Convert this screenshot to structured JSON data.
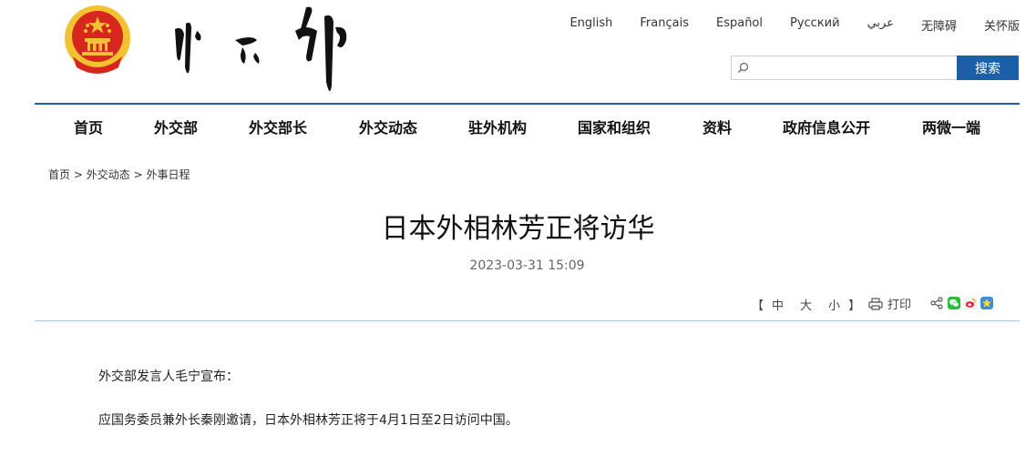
{
  "languages": [
    "English",
    "Français",
    "Español",
    "Русский",
    "عربي",
    "无障碍",
    "关怀版"
  ],
  "search": {
    "placeholder": "",
    "button_label": "搜索"
  },
  "nav": [
    "首页",
    "外交部",
    "外交部长",
    "外交动态",
    "驻外机构",
    "国家和组织",
    "资料",
    "政府信息公开",
    "两微一端"
  ],
  "breadcrumb": {
    "items": [
      "首页",
      "外交动态",
      "外事日程"
    ],
    "separator": ">"
  },
  "article": {
    "title": "日本外相林芳正将访华",
    "date": "2023-03-31 15:09",
    "paragraphs": [
      "外交部发言人毛宁宣布：",
      "应国务委员兼外长秦刚邀请，日本外相林芳正将于4月1日至2日访问中国。"
    ]
  },
  "font_size": {
    "open": "【",
    "close": "】",
    "options": [
      "中",
      "大",
      "小"
    ]
  },
  "print_label": "打印",
  "colors": {
    "accent": "#1b5fa8",
    "divider": "#a9c6e3",
    "emblem_red": "#d7261e",
    "emblem_gold": "#f2c230"
  },
  "icons": [
    "search-icon",
    "print-icon",
    "share-icon",
    "wechat-icon",
    "weibo-icon",
    "qzone-icon"
  ]
}
